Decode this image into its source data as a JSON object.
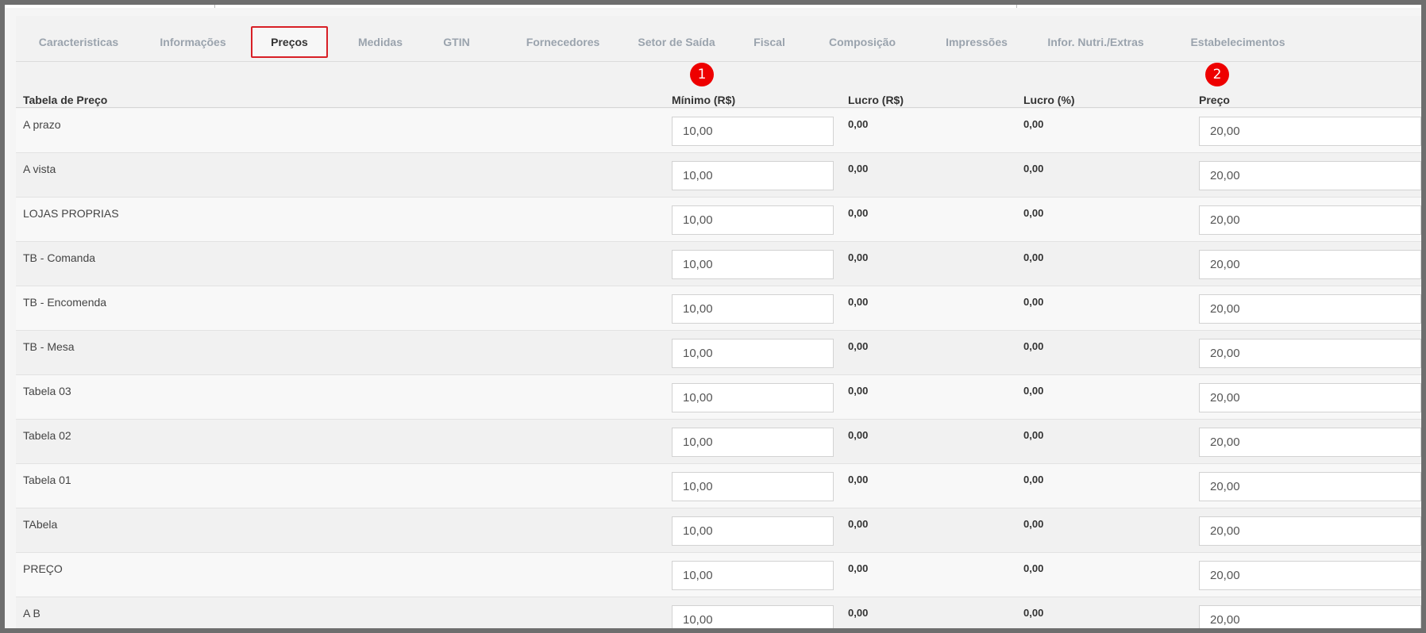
{
  "tabs": [
    {
      "label": "Caracteristicas",
      "active": false
    },
    {
      "label": "Informações",
      "active": false
    },
    {
      "label": "Preços",
      "active": true
    },
    {
      "label": "Medidas",
      "active": false
    },
    {
      "label": "GTIN",
      "active": false
    },
    {
      "label": "Fornecedores",
      "active": false
    },
    {
      "label": "Setor de Saída",
      "active": false
    },
    {
      "label": "Fiscal",
      "active": false
    },
    {
      "label": "Composição",
      "active": false
    },
    {
      "label": "Impressões",
      "active": false
    },
    {
      "label": "Infor. Nutri./Extras",
      "active": false
    },
    {
      "label": "Estabelecimentos",
      "active": false
    }
  ],
  "table": {
    "headers": {
      "tabela": "Tabela de Preço",
      "minimo": "Mínimo (R$)",
      "lucro_rs": "Lucro (R$)",
      "lucro_pct": "Lucro (%)",
      "preco": "Preço"
    },
    "badges": {
      "minimo": "1",
      "preco": "2"
    },
    "rows": [
      {
        "name": "A prazo",
        "minimo": "10,00",
        "lucro_rs": "0,00",
        "lucro_pct": "0,00",
        "preco": "20,00"
      },
      {
        "name": "A vista",
        "minimo": "10,00",
        "lucro_rs": "0,00",
        "lucro_pct": "0,00",
        "preco": "20,00"
      },
      {
        "name": "LOJAS PROPRIAS",
        "minimo": "10,00",
        "lucro_rs": "0,00",
        "lucro_pct": "0,00",
        "preco": "20,00"
      },
      {
        "name": "TB - Comanda",
        "minimo": "10,00",
        "lucro_rs": "0,00",
        "lucro_pct": "0,00",
        "preco": "20,00"
      },
      {
        "name": "TB - Encomenda",
        "minimo": "10,00",
        "lucro_rs": "0,00",
        "lucro_pct": "0,00",
        "preco": "20,00"
      },
      {
        "name": "TB - Mesa",
        "minimo": "10,00",
        "lucro_rs": "0,00",
        "lucro_pct": "0,00",
        "preco": "20,00"
      },
      {
        "name": "Tabela 03",
        "minimo": "10,00",
        "lucro_rs": "0,00",
        "lucro_pct": "0,00",
        "preco": "20,00"
      },
      {
        "name": "Tabela 02",
        "minimo": "10,00",
        "lucro_rs": "0,00",
        "lucro_pct": "0,00",
        "preco": "20,00"
      },
      {
        "name": "Tabela 01",
        "minimo": "10,00",
        "lucro_rs": "0,00",
        "lucro_pct": "0,00",
        "preco": "20,00"
      },
      {
        "name": "TAbela",
        "minimo": "10,00",
        "lucro_rs": "0,00",
        "lucro_pct": "0,00",
        "preco": "20,00"
      },
      {
        "name": "PREÇO",
        "minimo": "10,00",
        "lucro_rs": "0,00",
        "lucro_pct": "0,00",
        "preco": "20,00"
      },
      {
        "name": "A B",
        "minimo": "10,00",
        "lucro_rs": "0,00",
        "lucro_pct": "0,00",
        "preco": "20,00"
      }
    ]
  }
}
